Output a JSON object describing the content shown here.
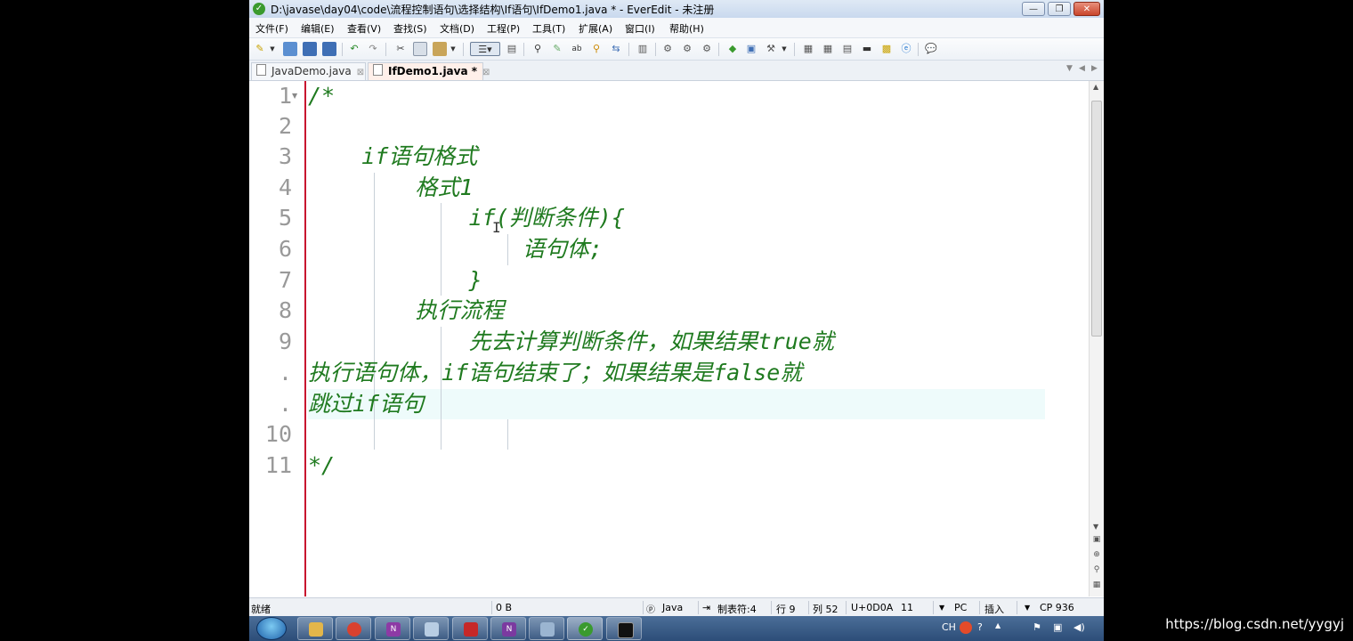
{
  "window": {
    "title": "D:\\javase\\day04\\code\\流程控制语句\\选择结构\\If语句\\IfDemo1.java * - EverEdit - 未注册",
    "controls": {
      "minimize": "—",
      "restore": "❐",
      "close": "✕"
    }
  },
  "menu": [
    "文件(F)",
    "编辑(E)",
    "查看(V)",
    "查找(S)",
    "文档(D)",
    "工程(P)",
    "工具(T)",
    "扩展(A)",
    "窗口(I)",
    "帮助(H)"
  ],
  "tabs": [
    {
      "label": "JavaDemo.java",
      "active": false
    },
    {
      "label": "IfDemo1.java *",
      "active": true
    }
  ],
  "editor": {
    "line_numbers": [
      "1",
      "2",
      "3",
      "4",
      "5",
      "6",
      "7",
      "8",
      "9",
      ".",
      ".",
      "10",
      "11"
    ],
    "lines": [
      "/*",
      "",
      "    if语句格式",
      "        格式1",
      "            if(判断条件){",
      "                语句体;",
      "            }",
      "        执行流程",
      "            先去计算判断条件，如果结果true就",
      "执行语句体，if语句结束了；如果结果是false就",
      "跳过if语句",
      "",
      "*/"
    ],
    "text_color": "#1f7a1f",
    "current_line_color": "#eefbfb"
  },
  "status": {
    "ready": "就绪",
    "size": "0 B",
    "language": "Java",
    "tab_setting": "制表符:4",
    "row": "行 9",
    "col": "列 52",
    "char_code": "U+0D0A",
    "char_dec": "11",
    "line_ending": "PC",
    "insert_mode": "插入",
    "codepage": "CP 936"
  },
  "taskbar": {
    "tray_lang": "CH",
    "apps": [
      "explorer",
      "chrome",
      "onenote-nx",
      "notepad",
      "pdf",
      "onenote",
      "paint",
      "everedit",
      "cmd"
    ]
  },
  "watermark": "https://blog.csdn.net/yygyj"
}
